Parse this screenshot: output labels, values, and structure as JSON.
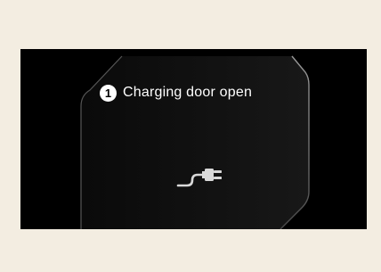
{
  "screen": {
    "status_number": "1",
    "status_message": "Charging door open"
  },
  "icons": {
    "charging_plug": "plug-icon",
    "door_outline": "charging-door-outline"
  },
  "colors": {
    "page_background": "#f3ede1",
    "display_background": "#000000",
    "text": "#ffffff",
    "icon": "#d9d9d9"
  }
}
